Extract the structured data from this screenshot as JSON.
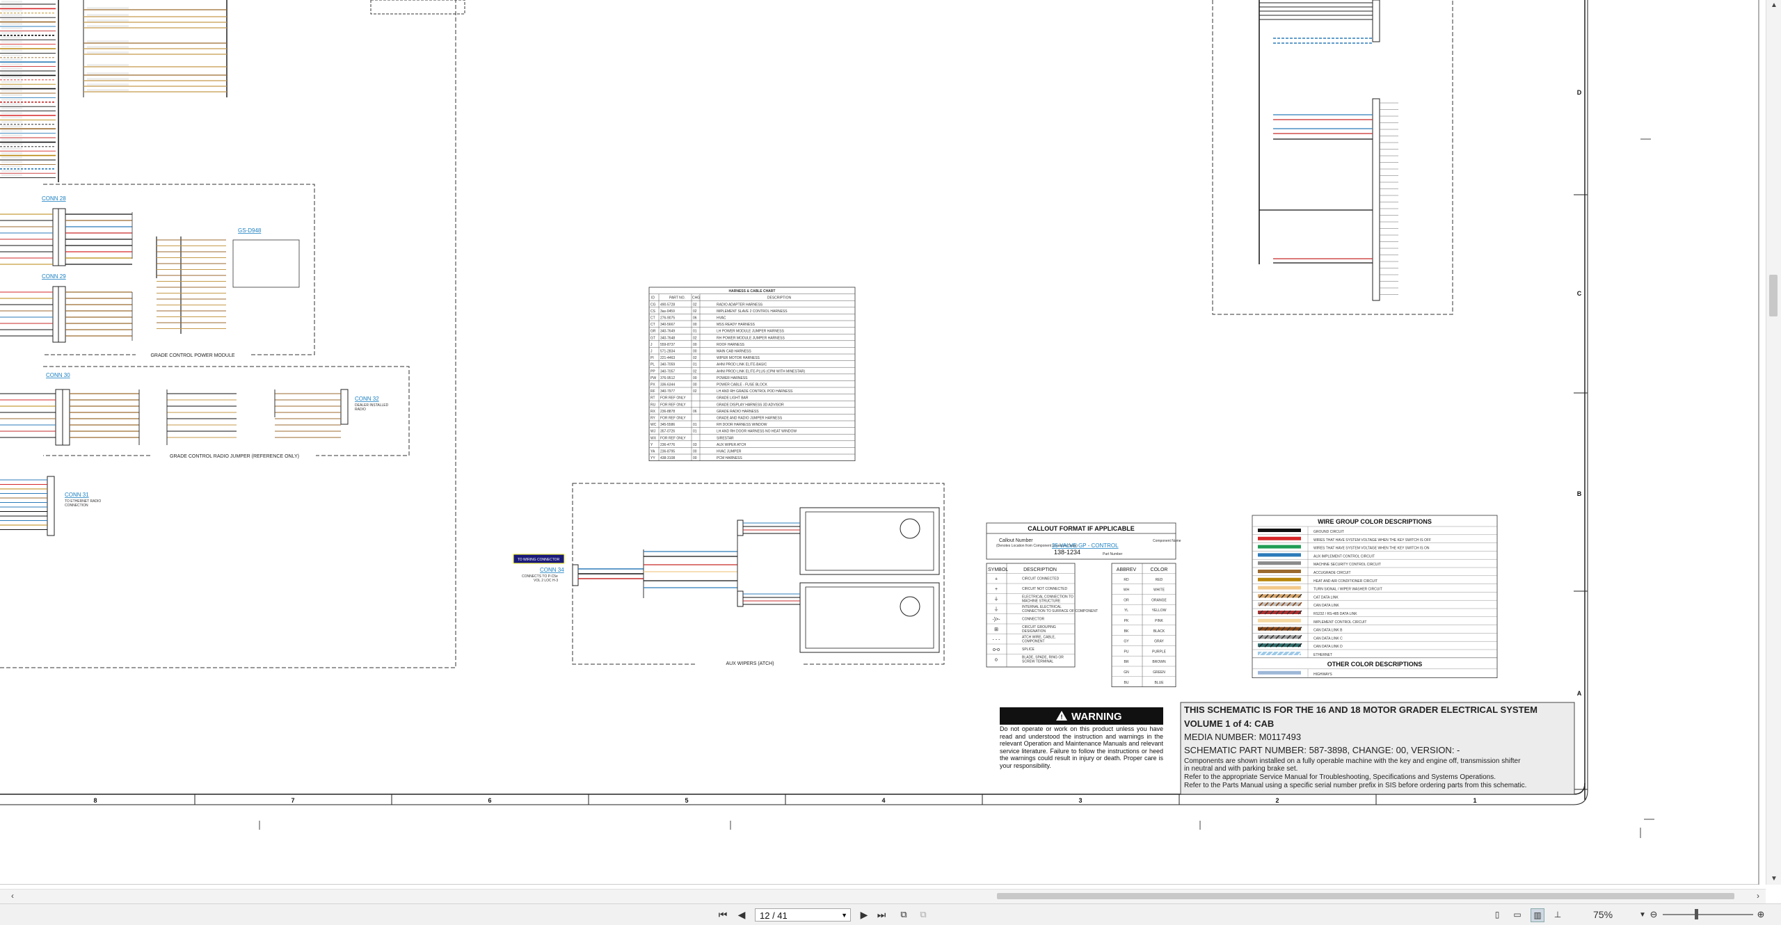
{
  "sheet": {
    "column_numbers": [
      "8",
      "7",
      "6",
      "5",
      "4",
      "3",
      "2",
      "1"
    ],
    "row_letters": [
      "D",
      "C",
      "B",
      "A"
    ],
    "connectors": {
      "conn28": "CONN 28",
      "conn29": "CONN 29",
      "conn30": "CONN 30",
      "conn31": "CONN 31",
      "conn31_desc1": "TO ETHERNET RADIO",
      "conn31_desc2": "CONNECTION",
      "conn32": "CONN 32",
      "conn32_desc1": "DEALER INSTALLED",
      "conn32_desc2": "RADIO",
      "conn34": "CONN 34",
      "conn34_desc1": "CONNECTS TO P-C5e",
      "conn34_desc2": "VOL 2 LOC H-3"
    },
    "callout_boxed": "TO WIRING CONNECTOR",
    "module_labels": {
      "grade_control_power": "GRADE CONTROL POWER MODULE",
      "grade_control_radio": "GRADE CONTROL RADIO JUMPER (REFERENCE ONLY)",
      "aux_wipers": "AUX WIPERS (ATCH)"
    },
    "grade_link": "GS-D948"
  },
  "harness_chart": {
    "title": "HARNESS & CABLE CHART",
    "headers": [
      "ID",
      "PART NO.",
      "CHG",
      "DESCRIPTION"
    ],
    "rows": [
      [
        "CG",
        "490-5728",
        "02",
        "RADIO ADAPTER HARNESS"
      ],
      [
        "CS",
        "3as-0459",
        "02",
        "IMPLEMENT SLAVE 2 CONTROL HARNESS"
      ],
      [
        "CT",
        "276-9075",
        "06",
        "HVAC"
      ],
      [
        "CT",
        "340-5667",
        "00",
        "MSS READY HARNESS"
      ],
      [
        "GR",
        "340-7649",
        "01",
        "LH POWER MODULE JUMPER HARNESS"
      ],
      [
        "GT",
        "340-7648",
        "02",
        "RH POWER MODULE JUMPER HARNESS"
      ],
      [
        "J",
        "559-8737",
        "00",
        "ROOF HARNESS"
      ],
      [
        "J",
        "571-2834",
        "00",
        "MAIN CAB HARNESS"
      ],
      [
        "PI",
        "221-4463",
        "02",
        "WIPER MOTOR HARNESS"
      ],
      [
        "PL",
        "340-7059",
        "01",
        "AHNI PROD LINK ELITE-BASIC"
      ],
      [
        "PP",
        "340-7057",
        "02",
        "AHNI PROD LINK ELITE-PLUS (CPM WITH MINESTAR)"
      ],
      [
        "PW",
        "376-9512",
        "00",
        "POWER HARNESS"
      ],
      [
        "PX",
        "336-6344",
        "00",
        "POWER CABLE - FUSE BLOCK"
      ],
      [
        "RF",
        "340-7977",
        "02",
        "LH AND RH GRADE CONTROL POD HARNESS"
      ],
      [
        "RT",
        "FOR REF ONLY",
        "",
        "GRADE LIGHT BAR"
      ],
      [
        "RU",
        "FOR REF ONLY",
        "",
        "GRADE DISPLAY HARNESS 3D ADVISOR"
      ],
      [
        "RX",
        "236-8878",
        "06",
        "GRADE RADIO HARNESS"
      ],
      [
        "RY",
        "FOR REF ONLY",
        "",
        "GRADE AND RADIO JUMPER HARNESS"
      ],
      [
        "WC",
        "345-5586",
        "01",
        "RH DOOR HARNESS WINDOW"
      ],
      [
        "WJ",
        "357-0726",
        "01",
        "LH AND RH DOOR HARNESS NO HEAT WINDOW"
      ],
      [
        "WX",
        "FOR REF ONLY",
        "",
        "SIRESTAR"
      ],
      [
        "Y",
        "236-4776",
        "03",
        "AUX WIPER ATCH"
      ],
      [
        "YA",
        "236-8795",
        "00",
        "HVAC JUMPER"
      ],
      [
        "YY",
        "438-3108",
        "00",
        "PCM HARNESS"
      ]
    ]
  },
  "callout_format": {
    "title": "CALLOUT FORMAT IF APPLICABLE",
    "left_label": "Callout Number",
    "left_sub": "(Denotes Location from Component Locations Table)",
    "link_text": "35 VALVE GP - CONTROL",
    "part_number": "138-1234",
    "part_sub": "Part Number",
    "right_label": "Component Name"
  },
  "symbol_table": {
    "headers": [
      "SYMBOL",
      "DESCRIPTION"
    ],
    "rows": [
      [
        "+",
        "CIRCUIT CONNECTED"
      ],
      [
        "+",
        "CIRCUIT NOT CONNECTED"
      ],
      [
        "⏚",
        "ELECTRICAL CONNECTION TO MACHINE STRUCTURE"
      ],
      [
        "⏚",
        "INTERNAL ELECTRICAL CONNECTION TO SURFACE OF COMPONENT"
      ],
      [
        "-)>-",
        "CONNECTOR"
      ],
      [
        "⊞",
        "CIRCUIT GROUPING DESIGNATION"
      ],
      [
        "- - -",
        "ATCH WIRE, CABLE, COMPONENT"
      ],
      [
        "o-o",
        "SPLICE"
      ],
      [
        "o",
        "BLADE, SPADE, RING OR SCREW TERMINAL"
      ]
    ]
  },
  "color_abbrev": {
    "headers": [
      "ABBREV",
      "COLOR"
    ],
    "rows": [
      [
        "RD",
        "RED"
      ],
      [
        "WH",
        "WHITE"
      ],
      [
        "OR",
        "ORANGE"
      ],
      [
        "YL",
        "YELLOW"
      ],
      [
        "PK",
        "PINK"
      ],
      [
        "BK",
        "BLACK"
      ],
      [
        "GY",
        "GRAY"
      ],
      [
        "PU",
        "PURPLE"
      ],
      [
        "BR",
        "BROWN"
      ],
      [
        "GN",
        "GREEN"
      ],
      [
        "BU",
        "BLUE"
      ]
    ]
  },
  "wire_groups": {
    "title": "WIRE GROUP COLOR DESCRIPTIONS",
    "rows": [
      {
        "label": "GROUND CIRCUIT",
        "colors": [
          "#111111"
        ]
      },
      {
        "label": "WIRES THAT HAVE SYSTEM VOLTAGE WHEN THE KEY SWITCH IS OFF",
        "colors": [
          "#d62728"
        ]
      },
      {
        "label": "WIRES THAT HAVE SYSTEM VOLTAGE WHEN THE KEY SWITCH IS ON",
        "colors": [
          "#1f9d55"
        ]
      },
      {
        "label": "AUX IMPLEMENT CONTROL CIRCUIT",
        "colors": [
          "#2b7bb9"
        ]
      },
      {
        "label": "MACHINE SECURITY CONTROL CIRCUIT",
        "colors": [
          "#8a8a8a"
        ]
      },
      {
        "label": "ACCUGRADE CIRCUIT",
        "colors": [
          "#9b6a2f"
        ]
      },
      {
        "label": "HEAT AND AIR CONDITIONER CIRCUIT",
        "colors": [
          "#b8860b"
        ]
      },
      {
        "label": "TURN SIGNAL / WIPER WASHER CIRCUIT",
        "colors": [
          "#f2c98a"
        ]
      },
      {
        "label": "CAT DATA LINK",
        "colors": [
          "#d9a66a",
          "#333333"
        ]
      },
      {
        "label": "CAN DATA LINK",
        "colors": [
          "#c0c0c0",
          "#8b4513"
        ]
      },
      {
        "label": "RS232 / RS-485 DATA LINK",
        "colors": [
          "#b03030",
          "#333333"
        ]
      },
      {
        "label": "IMPLEMENT CONTROL CIRCUIT",
        "colors": [
          "#f5d7a1"
        ]
      },
      {
        "label": "CAN DATA LINK B",
        "colors": [
          "#8b4513",
          "#333333"
        ]
      },
      {
        "label": "CAN DATA LINK C",
        "colors": [
          "#a0a0a0",
          "#333333"
        ]
      },
      {
        "label": "CAN DATA LINK D",
        "colors": [
          "#2f6f6f",
          "#222222"
        ]
      },
      {
        "label": "ETHERNET",
        "colors": [
          "#9ec9e8",
          "#ffffff"
        ]
      }
    ],
    "other_title": "OTHER COLOR DESCRIPTIONS",
    "other_rows": [
      {
        "label": "HIGHWAYS",
        "colors": [
          "#9db7d8"
        ]
      }
    ]
  },
  "warning": {
    "title": "WARNING",
    "text": "Do not operate or work on this product unless you have read and understood the instruction and warnings in the relevant Operation and Maintenance Manuals and relevant service literature. Failure to follow the instructions or heed the warnings could result in injury or death. Proper care is your responsibility."
  },
  "title_block": {
    "line1": "THIS SCHEMATIC IS FOR THE 16 AND 18 MOTOR GRADER ELECTRICAL SYSTEM",
    "line2": "VOLUME 1 of 4: CAB",
    "media": "MEDIA NUMBER: M0117493",
    "part": "SCHEMATIC PART NUMBER: 587-3898, CHANGE: 00, VERSION: -",
    "note1": "Components are shown installed on a fully operable machine with the key and engine off, transmission shifter",
    "note2": "in neutral and with parking brake set.",
    "note3": "Refer to the appropriate Service Manual for Troubleshooting, Specifications and Systems Operations.",
    "note4": "Refer to the Parts Manual using a specific serial number prefix in SIS before ordering parts from this schematic."
  },
  "toolbar": {
    "page_display": "12 / 41",
    "zoom": "75%"
  }
}
